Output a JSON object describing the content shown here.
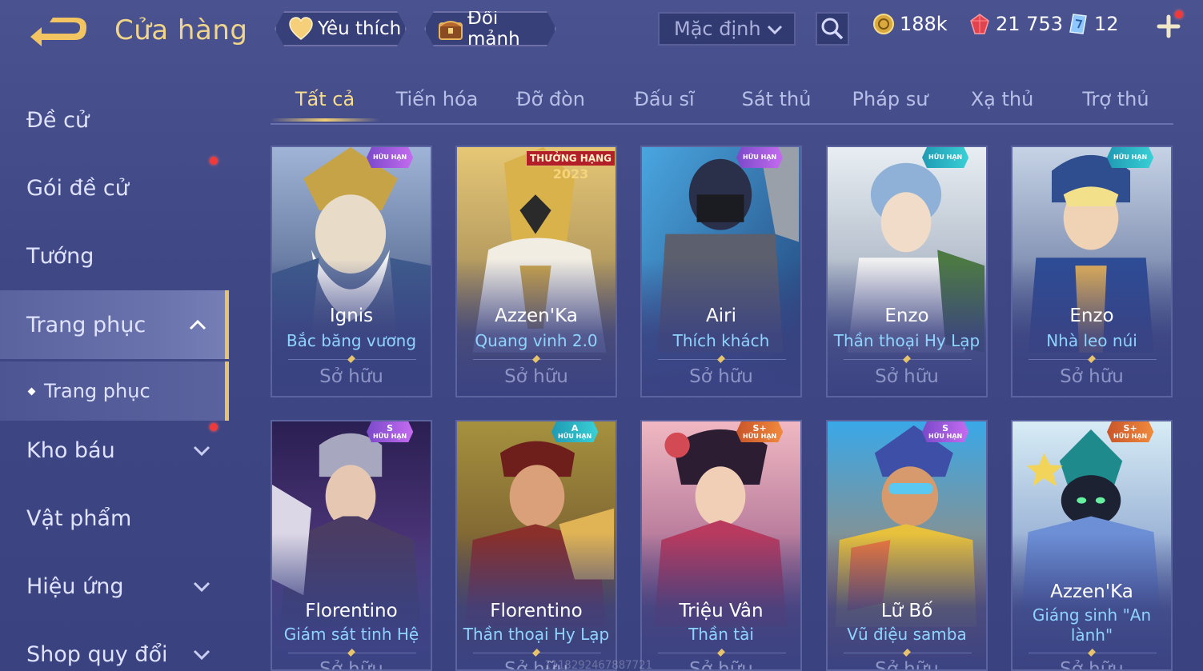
{
  "header": {
    "title": "Cửa hàng",
    "favorites_label": "Yêu thích",
    "exchange_label": "Đổi mảnh",
    "sort": {
      "selected": "Mặc định"
    },
    "currencies": [
      {
        "name": "gold-coin",
        "value": "188k"
      },
      {
        "name": "ruby",
        "value": "21 753"
      },
      {
        "name": "voucher",
        "value": "12"
      }
    ]
  },
  "sidebar": {
    "items": [
      {
        "label": "Đề cử"
      },
      {
        "label": "Gói đề cử"
      },
      {
        "label": "Tướng"
      },
      {
        "label": "Trang phục"
      },
      {
        "label": "Trang phục"
      },
      {
        "label": "Kho báu"
      },
      {
        "label": "Vật phẩm"
      },
      {
        "label": "Hiệu ứng"
      },
      {
        "label": "Shop quy đổi"
      }
    ]
  },
  "tabs": [
    "Tất cả",
    "Tiến hóa",
    "Đỡ đòn",
    "Đấu sĩ",
    "Sát thủ",
    "Pháp sư",
    "Xạ thủ",
    "Trợ thủ"
  ],
  "cards": [
    {
      "hero": "Ignis",
      "skin": "Bắc băng vương",
      "owned": "Sở hữu",
      "badge_rank": "",
      "badge_lim": "HỮU HẠN"
    },
    {
      "hero": "Azzen'Ka",
      "skin": "Quang vinh 2.0",
      "owned": "Sở hữu",
      "event_t1": "THƯỞNG HẠNG",
      "event_t2": "2023"
    },
    {
      "hero": "Airi",
      "skin": "Thích khách",
      "owned": "Sở hữu",
      "badge_rank": "",
      "badge_lim": "HỮU HẠN"
    },
    {
      "hero": "Enzo",
      "skin": "Thần thoại Hy Lạp",
      "owned": "Sở hữu",
      "badge_rank": "",
      "badge_lim": "HỮU HẠN"
    },
    {
      "hero": "Enzo",
      "skin": "Nhà leo núi",
      "owned": "Sở hữu",
      "badge_rank": "",
      "badge_lim": "HỮU HẠN"
    },
    {
      "hero": "Florentino",
      "skin": "Giám sát tinh Hệ",
      "owned": "Sở hữu",
      "badge_rank": "S",
      "badge_lim": "HỮU HẠN"
    },
    {
      "hero": "Florentino",
      "skin": "Thần thoại Hy Lạp",
      "owned": "Sở hữu",
      "badge_rank": "A",
      "badge_lim": "HỮU HẠN"
    },
    {
      "hero": "Triệu Vân",
      "skin": "Thần tài",
      "owned": "Sở hữu",
      "badge_rank": "S+",
      "badge_lim": "HỮU HẠN"
    },
    {
      "hero": "Lữ Bố",
      "skin": "Vũ điệu samba",
      "owned": "Sở hữu",
      "badge_rank": "S",
      "badge_lim": "HỮU HẠN"
    },
    {
      "hero": "Azzen'Ka",
      "skin": "Giáng sinh \"An lành\"",
      "owned": "Sở hữu",
      "badge_rank": "S+",
      "badge_lim": "HỮU HẠN"
    }
  ],
  "watermark": "1118292467887721"
}
